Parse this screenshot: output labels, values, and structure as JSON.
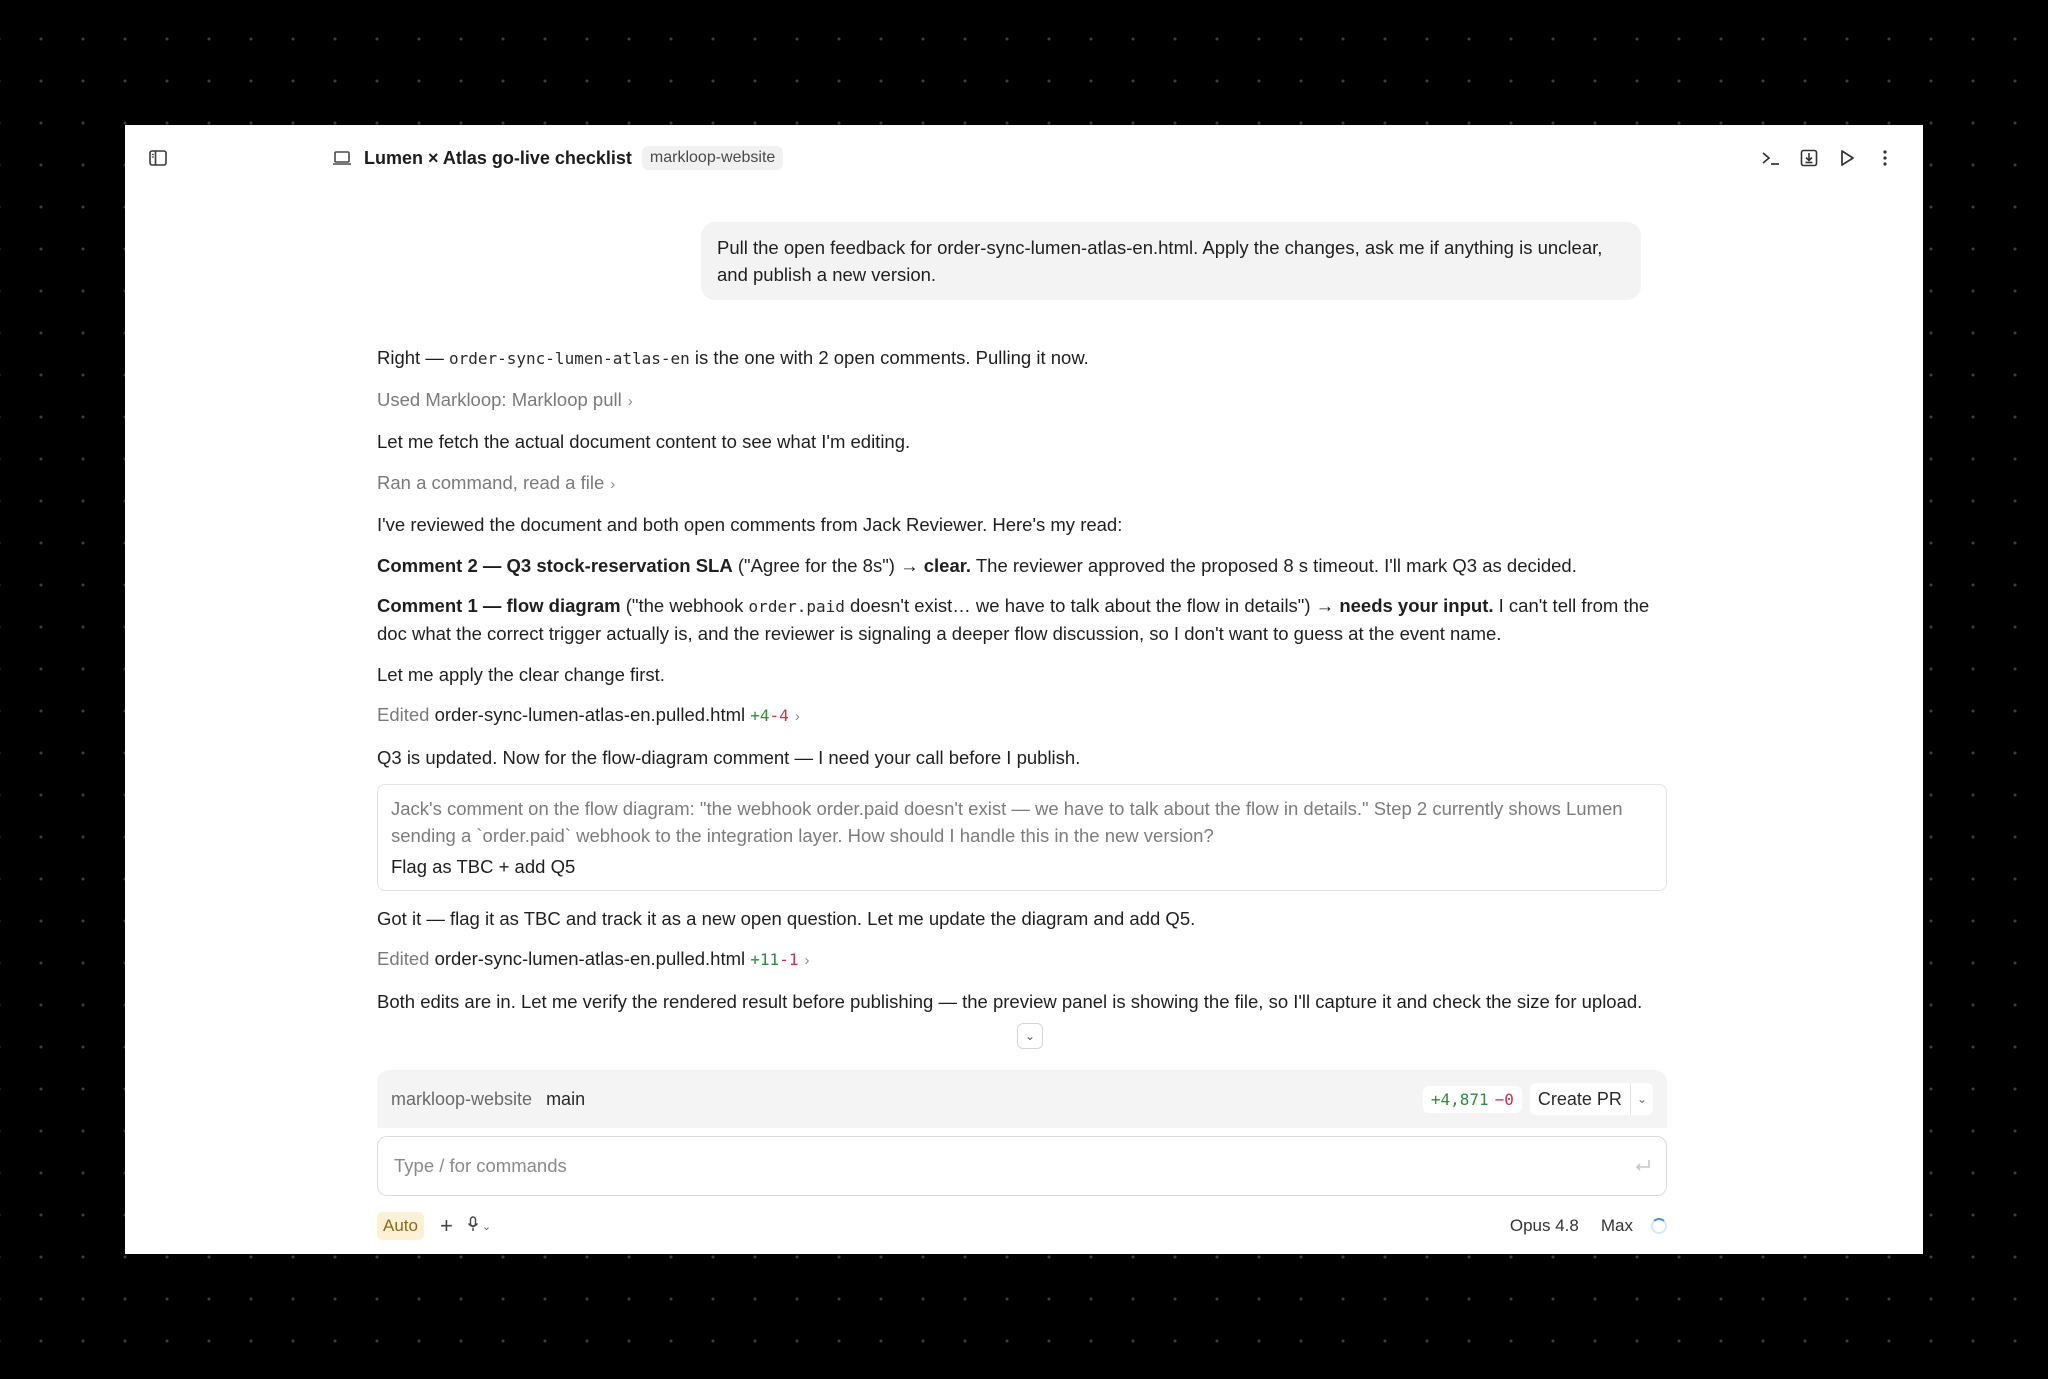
{
  "header": {
    "title": "Lumen × Atlas go-live checklist",
    "repo_tag": "markloop-website"
  },
  "user_message": "Pull the open feedback for order-sync-lumen-atlas-en.html. Apply the changes, ask me if anything is unclear, and publish a new version.",
  "conversation": {
    "m1_pre": "Right — ",
    "m1_code": "order-sync-lumen-atlas-en",
    "m1_post": " is the one with 2 open comments. Pulling it now.",
    "tool1": "Used Markloop: Markloop pull",
    "m2": "Let me fetch the actual document content to see what I'm editing.",
    "tool2": "Ran a command, read a file",
    "m3": "I've reviewed the document and both open comments from Jack Reviewer. Here's my read:",
    "c2_bold": "Comment 2 — Q3 stock-reservation SLA",
    "c2_mid": " (\"Agree for the 8s\") → ",
    "c2_bold2": "clear.",
    "c2_rest": " The reviewer approved the proposed 8 s timeout. I'll mark Q3 as decided.",
    "c1_bold": "Comment 1 — flow diagram",
    "c1_a": " (\"the webhook ",
    "c1_code": "order.paid",
    "c1_b": " doesn't exist… we have to talk about the flow in details\") → ",
    "c1_bold2": "needs your input.",
    "c1_rest": " I can't tell from the doc what the correct trigger actually is, and the reviewer is signaling a deeper flow discussion, so I don't want to guess at the event name.",
    "m4": "Let me apply the clear change first.",
    "edit1": {
      "label": "Edited",
      "file": "order-sync-lumen-atlas-en.pulled.html",
      "add": "+4",
      "del": "-4"
    },
    "m5": "Q3 is updated. Now for the flow-diagram comment — I need your call before I publish.",
    "question": "Jack's comment on the flow diagram: \"the webhook order.paid doesn't exist — we have to talk about the flow in details.\" Step 2 currently shows Lumen sending a `order.paid` webhook to the integration layer. How should I handle this in the new version?",
    "answer": "Flag as TBC + add Q5",
    "m6": "Got it — flag it as TBC and track it as a new open question. Let me update the diagram and add Q5.",
    "edit2": {
      "label": "Edited",
      "file": "order-sync-lumen-atlas-en.pulled.html",
      "add": "+11",
      "del": "-1"
    },
    "m7": "Both edits are in. Let me verify the rendered result before publishing — the preview panel is showing the file, so I'll capture it and check the size for upload."
  },
  "branch_bar": {
    "repo": "markloop-website",
    "branch": "main",
    "additions": "+4,871",
    "deletions": "−0",
    "create_pr": "Create PR"
  },
  "composer": {
    "placeholder": "Type / for commands"
  },
  "footer": {
    "mode": "Auto",
    "model": "Opus 4.8",
    "effort": "Max"
  },
  "icons": [
    "sidebar-toggle-icon",
    "laptop-icon",
    "terminal-icon",
    "download-icon",
    "play-icon",
    "more-vertical-icon",
    "chevron-right-icon",
    "chevron-down-icon",
    "enter-icon",
    "plus-icon",
    "microphone-icon",
    "spinner-icon"
  ]
}
